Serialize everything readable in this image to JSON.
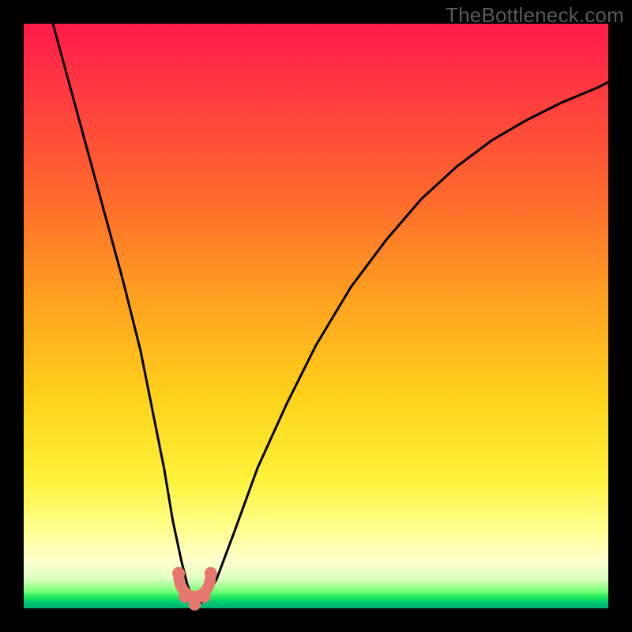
{
  "watermark": "TheBottleneck.com",
  "chart_data": {
    "type": "line",
    "title": "",
    "xlabel": "",
    "ylabel": "",
    "xlim": [
      0,
      100
    ],
    "ylim": [
      0,
      100
    ],
    "grid": false,
    "legend": false,
    "series": [
      {
        "name": "bottleneck-curve",
        "x": [
          5,
          8,
          11,
          14,
          17,
          20,
          22,
          24,
          25.5,
          27,
          28,
          29,
          30,
          31,
          33,
          36,
          40,
          45,
          50,
          56,
          62,
          68,
          74,
          80,
          86,
          92,
          98,
          100
        ],
        "y": [
          100,
          89,
          78,
          67,
          56,
          44,
          34,
          24,
          15,
          8,
          4,
          1.5,
          0.7,
          1.5,
          5,
          13,
          24,
          35,
          45,
          55,
          63,
          70,
          75.5,
          80,
          83.5,
          86.5,
          89,
          90
        ]
      }
    ],
    "annotations": [
      {
        "name": "min-marker-u",
        "x_range": [
          26.5,
          32
        ],
        "y": 2,
        "style": "salmon-u"
      }
    ],
    "background_gradient": {
      "top": "#ff1a4a",
      "mid": "#ffd21a",
      "bottom": "#00b06e"
    }
  }
}
